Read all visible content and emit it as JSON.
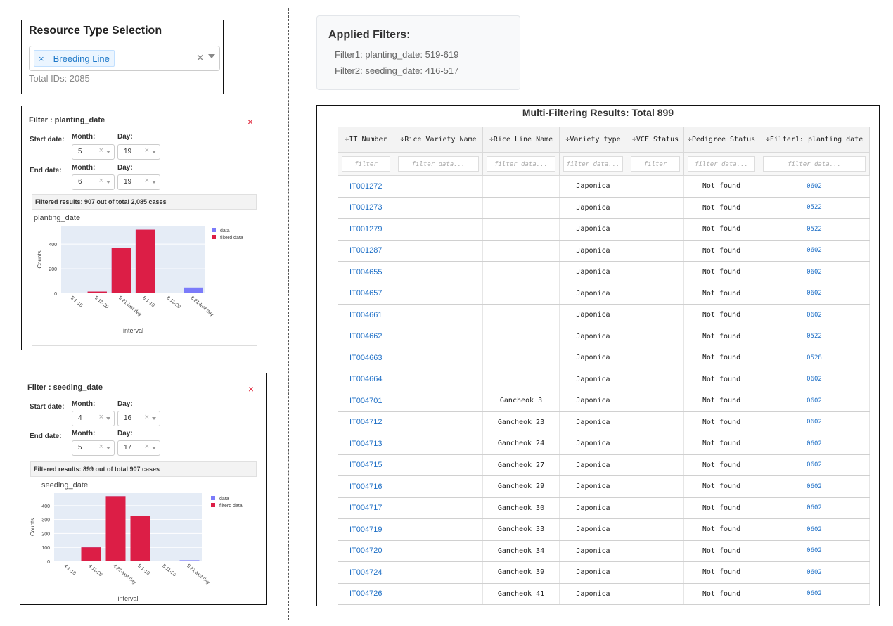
{
  "resource_type": {
    "title": "Resource Type Selection",
    "chip_x": "×",
    "selected": "Breeding Line",
    "clear_icon": "×",
    "total": "Total IDs: 2085"
  },
  "filters": [
    {
      "title": "Filter : planting_date",
      "close": "×",
      "start_label": "Start date:",
      "end_label": "End date:",
      "month_label": "Month:",
      "day_label": "Day:",
      "start_month": "5",
      "start_day": "19",
      "end_month": "6",
      "end_day": "19",
      "result_text": "Filtered results: 907 out of total 2,085 cases"
    },
    {
      "title": "Filter : seeding_date",
      "close": "×",
      "start_label": "Start date:",
      "end_label": "End date:",
      "month_label": "Month:",
      "day_label": "Day:",
      "start_month": "4",
      "start_day": "16",
      "end_month": "5",
      "end_day": "17",
      "result_text": "Filtered results: 899 out of total 907 cases"
    }
  ],
  "applied_filters": {
    "title": "Applied Filters:",
    "items": [
      "Filter1: planting_date: 519-619",
      "Filter2: seeding_date: 416-517"
    ]
  },
  "results": {
    "title": "Multi-Filtering Results: Total 899",
    "columns": [
      "÷IT Number",
      "÷Rice Variety Name",
      "÷Rice Line Name",
      "÷Variety_type",
      "÷VCF Status",
      "÷Pedigree Status",
      "÷Filter1: planting_date"
    ],
    "filter_placeholders": [
      "filter",
      "filter data...",
      "filter data...",
      "filter data...",
      "filter",
      "filter data...",
      "filter data..."
    ],
    "rows": [
      [
        "IT001272",
        "",
        "",
        "Japonica",
        "",
        "Not found",
        "0602"
      ],
      [
        "IT001273",
        "",
        "",
        "Japonica",
        "",
        "Not found",
        "0522"
      ],
      [
        "IT001279",
        "",
        "",
        "Japonica",
        "",
        "Not found",
        "0522"
      ],
      [
        "IT001287",
        "",
        "",
        "Japonica",
        "",
        "Not found",
        "0602"
      ],
      [
        "IT004655",
        "",
        "",
        "Japonica",
        "",
        "Not found",
        "0602"
      ],
      [
        "IT004657",
        "",
        "",
        "Japonica",
        "",
        "Not found",
        "0602"
      ],
      [
        "IT004661",
        "",
        "",
        "Japonica",
        "",
        "Not found",
        "0602"
      ],
      [
        "IT004662",
        "",
        "",
        "Japonica",
        "",
        "Not found",
        "0522"
      ],
      [
        "IT004663",
        "",
        "",
        "Japonica",
        "",
        "Not found",
        "0528"
      ],
      [
        "IT004664",
        "",
        "",
        "Japonica",
        "",
        "Not found",
        "0602"
      ],
      [
        "IT004701",
        "",
        "Gancheok 3",
        "Japonica",
        "",
        "Not found",
        "0602"
      ],
      [
        "IT004712",
        "",
        "Gancheok 23",
        "Japonica",
        "",
        "Not found",
        "0602"
      ],
      [
        "IT004713",
        "",
        "Gancheok 24",
        "Japonica",
        "",
        "Not found",
        "0602"
      ],
      [
        "IT004715",
        "",
        "Gancheok 27",
        "Japonica",
        "",
        "Not found",
        "0602"
      ],
      [
        "IT004716",
        "",
        "Gancheok 29",
        "Japonica",
        "",
        "Not found",
        "0602"
      ],
      [
        "IT004717",
        "",
        "Gancheok 30",
        "Japonica",
        "",
        "Not found",
        "0602"
      ],
      [
        "IT004719",
        "",
        "Gancheok 33",
        "Japonica",
        "",
        "Not found",
        "0602"
      ],
      [
        "IT004720",
        "",
        "Gancheok 34",
        "Japonica",
        "",
        "Not found",
        "0602"
      ],
      [
        "IT004724",
        "",
        "Gancheok 39",
        "Japonica",
        "",
        "Not found",
        "0602"
      ],
      [
        "IT004726",
        "",
        "Gancheok 41",
        "Japonica",
        "",
        "Not found",
        "0602"
      ]
    ]
  },
  "chart_data": [
    {
      "type": "bar",
      "title": "planting_date",
      "xlabel": "interval",
      "ylabel": "Counts",
      "categories": [
        "5 1-10",
        "5 11-20",
        "5 21-last day",
        "6 1-10",
        "6 11-20",
        "6 21-last day"
      ],
      "series": [
        {
          "name": "data",
          "color": "#7b7bfa",
          "values": [
            0,
            14,
            368,
            518,
            0,
            47
          ]
        },
        {
          "name": "filterd data",
          "color": "#dc1e46",
          "values": [
            0,
            14,
            368,
            518,
            0,
            0
          ]
        }
      ],
      "yticks": [
        0,
        200,
        400
      ],
      "ylim": [
        0,
        550
      ],
      "legend": "top-right",
      "grid": true
    },
    {
      "type": "bar",
      "title": "seeding_date",
      "xlabel": "interval",
      "ylabel": "Counts",
      "categories": [
        "4 1-10",
        "4 11-20",
        "4 21-last day",
        "5 1-10",
        "5 11-20",
        "5 21-last day"
      ],
      "series": [
        {
          "name": "data",
          "color": "#7b7bfa",
          "values": [
            0,
            100,
            468,
            326,
            0,
            8
          ]
        },
        {
          "name": "filterd data",
          "color": "#dc1e46",
          "values": [
            0,
            100,
            468,
            326,
            0,
            0
          ]
        }
      ],
      "yticks": [
        0,
        100,
        200,
        300,
        400
      ],
      "ylim": [
        0,
        490
      ],
      "legend": "top-right",
      "grid": true
    }
  ]
}
